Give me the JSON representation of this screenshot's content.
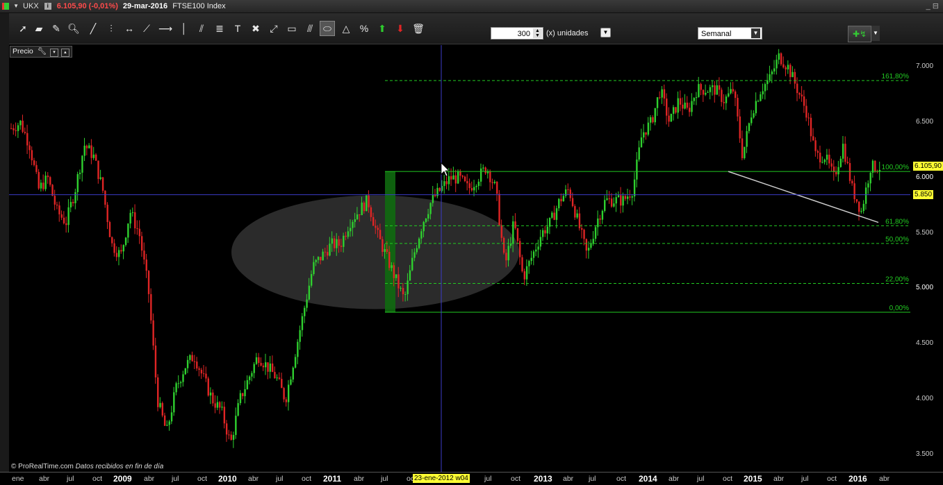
{
  "window": {
    "symbol": "UKX",
    "price_change": "6.105,90 (-0,01%)",
    "date": "29-mar-2016",
    "name": "FTSE100 Index",
    "controls": "_ ⊟"
  },
  "toolbar": {
    "units_value": "300",
    "units_label": "(x) unidades",
    "period_value": "Semanal",
    "icons": [
      "pointer-icon",
      "ruler-icon",
      "bell-icon",
      "zoom-icon",
      "line-icon",
      "vertical-line-icon",
      "horizontal-arrows-icon",
      "trendline-icon",
      "horizontal-line-icon",
      "vertical-bar-icon",
      "channel-icon",
      "fibonacci-icon",
      "text-icon",
      "tools-icon",
      "arrow-up-right-icon",
      "rectangle-icon",
      "parallel-icon",
      "ellipse-icon",
      "triangle-icon",
      "percent-icon",
      "green-arrow-icon",
      "red-arrow-icon",
      "trash-icon"
    ]
  },
  "panel": {
    "label": "Precio"
  },
  "footer": {
    "brand": "© ProRealTime.com",
    "note": "Datos recibidos en fin de día"
  },
  "crosshair": {
    "date_label": "23-ene-2012 w04",
    "price_label": "5.850"
  },
  "last_price_label": "6.105,90",
  "chart_data": {
    "type": "candlestick",
    "ylim": [
      3.35,
      7.2
    ],
    "y_ticks": [
      "7.000",
      "6.500",
      "6.000",
      "5.500",
      "5.000",
      "4.500",
      "4.000",
      "3.500"
    ],
    "x_ticks": [
      "ene",
      "abr",
      "jul",
      "oct",
      "2009",
      "abr",
      "jul",
      "oct",
      "2010",
      "abr",
      "jul",
      "oct",
      "2011",
      "abr",
      "jul",
      "oct",
      "abr",
      "jul",
      "oct",
      "2013",
      "abr",
      "jul",
      "oct",
      "2014",
      "abr",
      "jul",
      "oct",
      "2015",
      "abr",
      "jul",
      "oct",
      "2016",
      "abr"
    ],
    "series_path": [
      6.45,
      6.5,
      6.3,
      5.9,
      6.0,
      5.7,
      5.6,
      5.9,
      6.3,
      6.2,
      5.9,
      5.4,
      5.3,
      5.7,
      5.5,
      5.0,
      4.0,
      3.7,
      4.1,
      4.3,
      4.4,
      4.2,
      4.0,
      3.9,
      3.6,
      4.0,
      4.2,
      4.4,
      4.3,
      4.2,
      4.0,
      4.4,
      4.8,
      5.2,
      5.3,
      5.4,
      5.4,
      5.6,
      5.7,
      5.8,
      5.5,
      5.3,
      5.1,
      4.9,
      5.3,
      5.6,
      5.8,
      5.9,
      6.0,
      6.0,
      5.9,
      6.0,
      6.1,
      5.9,
      5.2,
      5.6,
      5.1,
      5.3,
      5.5,
      5.6,
      5.8,
      5.9,
      5.6,
      5.3,
      5.6,
      5.8,
      5.8,
      5.8,
      5.9,
      6.4,
      6.5,
      6.8,
      6.5,
      6.7,
      6.6,
      6.8,
      6.8,
      6.8,
      6.7,
      6.8,
      6.2,
      6.6,
      6.8,
      6.9,
      7.1,
      7.0,
      6.8,
      6.6,
      6.2,
      6.2,
      6.0,
      6.3,
      5.9,
      5.7,
      6.1,
      6.1
    ],
    "fibonacci": [
      {
        "label": "161,80%",
        "price": 6.88
      },
      {
        "label": "100,00%",
        "price": 6.06
      },
      {
        "label": "61,80%",
        "price": 5.57
      },
      {
        "label": "50,00%",
        "price": 5.41
      },
      {
        "label": "22,00%",
        "price": 5.05
      },
      {
        "label": "0,00%",
        "price": 4.79
      }
    ],
    "crosshair_price": 5.85,
    "last_price": 6.1059,
    "colors": {
      "up": "#2fd12f",
      "down": "#e02525",
      "fib": "#22cc22",
      "crosshair": "#3b3bc8",
      "trend": "#cccccc"
    }
  }
}
